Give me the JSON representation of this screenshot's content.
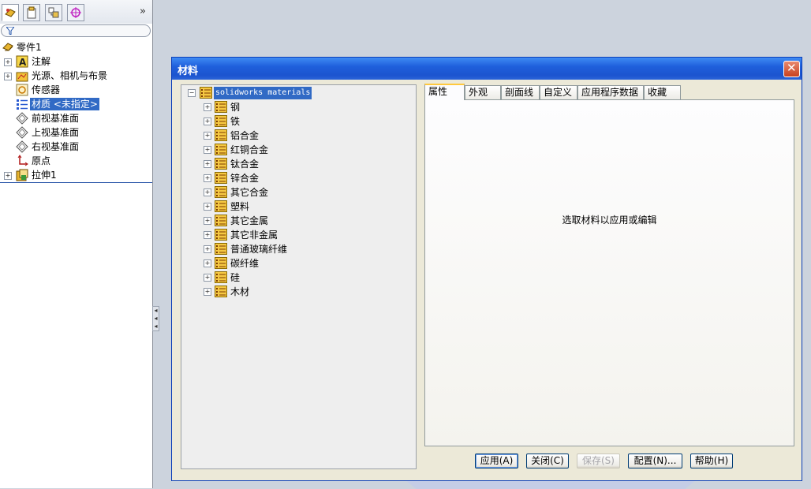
{
  "feature_manager": {
    "tabs": [
      "featuremanager-tab",
      "propertymanager-tab",
      "configurationmanager-tab",
      "dimxpert-tab"
    ],
    "expand_glyph": "»",
    "tree": [
      {
        "label": "零件1",
        "icon": "part-icon",
        "expandable": false
      },
      {
        "label": "注解",
        "icon": "annotations-icon",
        "expandable": true
      },
      {
        "label": "光源、相机与布景",
        "icon": "lights-cameras-scene-icon",
        "expandable": true
      },
      {
        "label": "传感器",
        "icon": "sensors-icon",
        "expandable": false
      },
      {
        "label": "材质 <未指定>",
        "icon": "material-icon",
        "expandable": false,
        "selected": true
      },
      {
        "label": "前视基准面",
        "icon": "plane-icon",
        "expandable": false
      },
      {
        "label": "上视基准面",
        "icon": "plane-icon",
        "expandable": false
      },
      {
        "label": "右视基准面",
        "icon": "plane-icon",
        "expandable": false
      },
      {
        "label": "原点",
        "icon": "origin-icon",
        "expandable": false
      },
      {
        "label": "拉伸1",
        "icon": "extrude-icon",
        "expandable": true
      }
    ]
  },
  "dialog": {
    "title": "材料",
    "close_glyph": "✕",
    "materials_tree": {
      "root": "solidworks materials",
      "root_expander": "−",
      "child_expander": "+",
      "items": [
        "钢",
        "铁",
        "铝合金",
        "红铜合金",
        "钛合金",
        "锌合金",
        "其它合金",
        "塑料",
        "其它金属",
        "其它非金属",
        "普通玻璃纤维",
        "碳纤维",
        "硅",
        "木材"
      ]
    },
    "tabs": [
      "属性",
      "外观",
      "剖面线",
      "自定义",
      "应用程序数据",
      "收藏"
    ],
    "active_tab": "属性",
    "placeholder_message": "选取材料以应用或编辑",
    "buttons": {
      "apply": "应用(A)",
      "close": "关闭(C)",
      "save": "保存(S)",
      "config": "配置(N)...",
      "help": "帮助(H)"
    }
  },
  "colors": {
    "title_bar": "#1f5fdc",
    "selection": "#316ac5",
    "dialog_face": "#ece9d8"
  }
}
